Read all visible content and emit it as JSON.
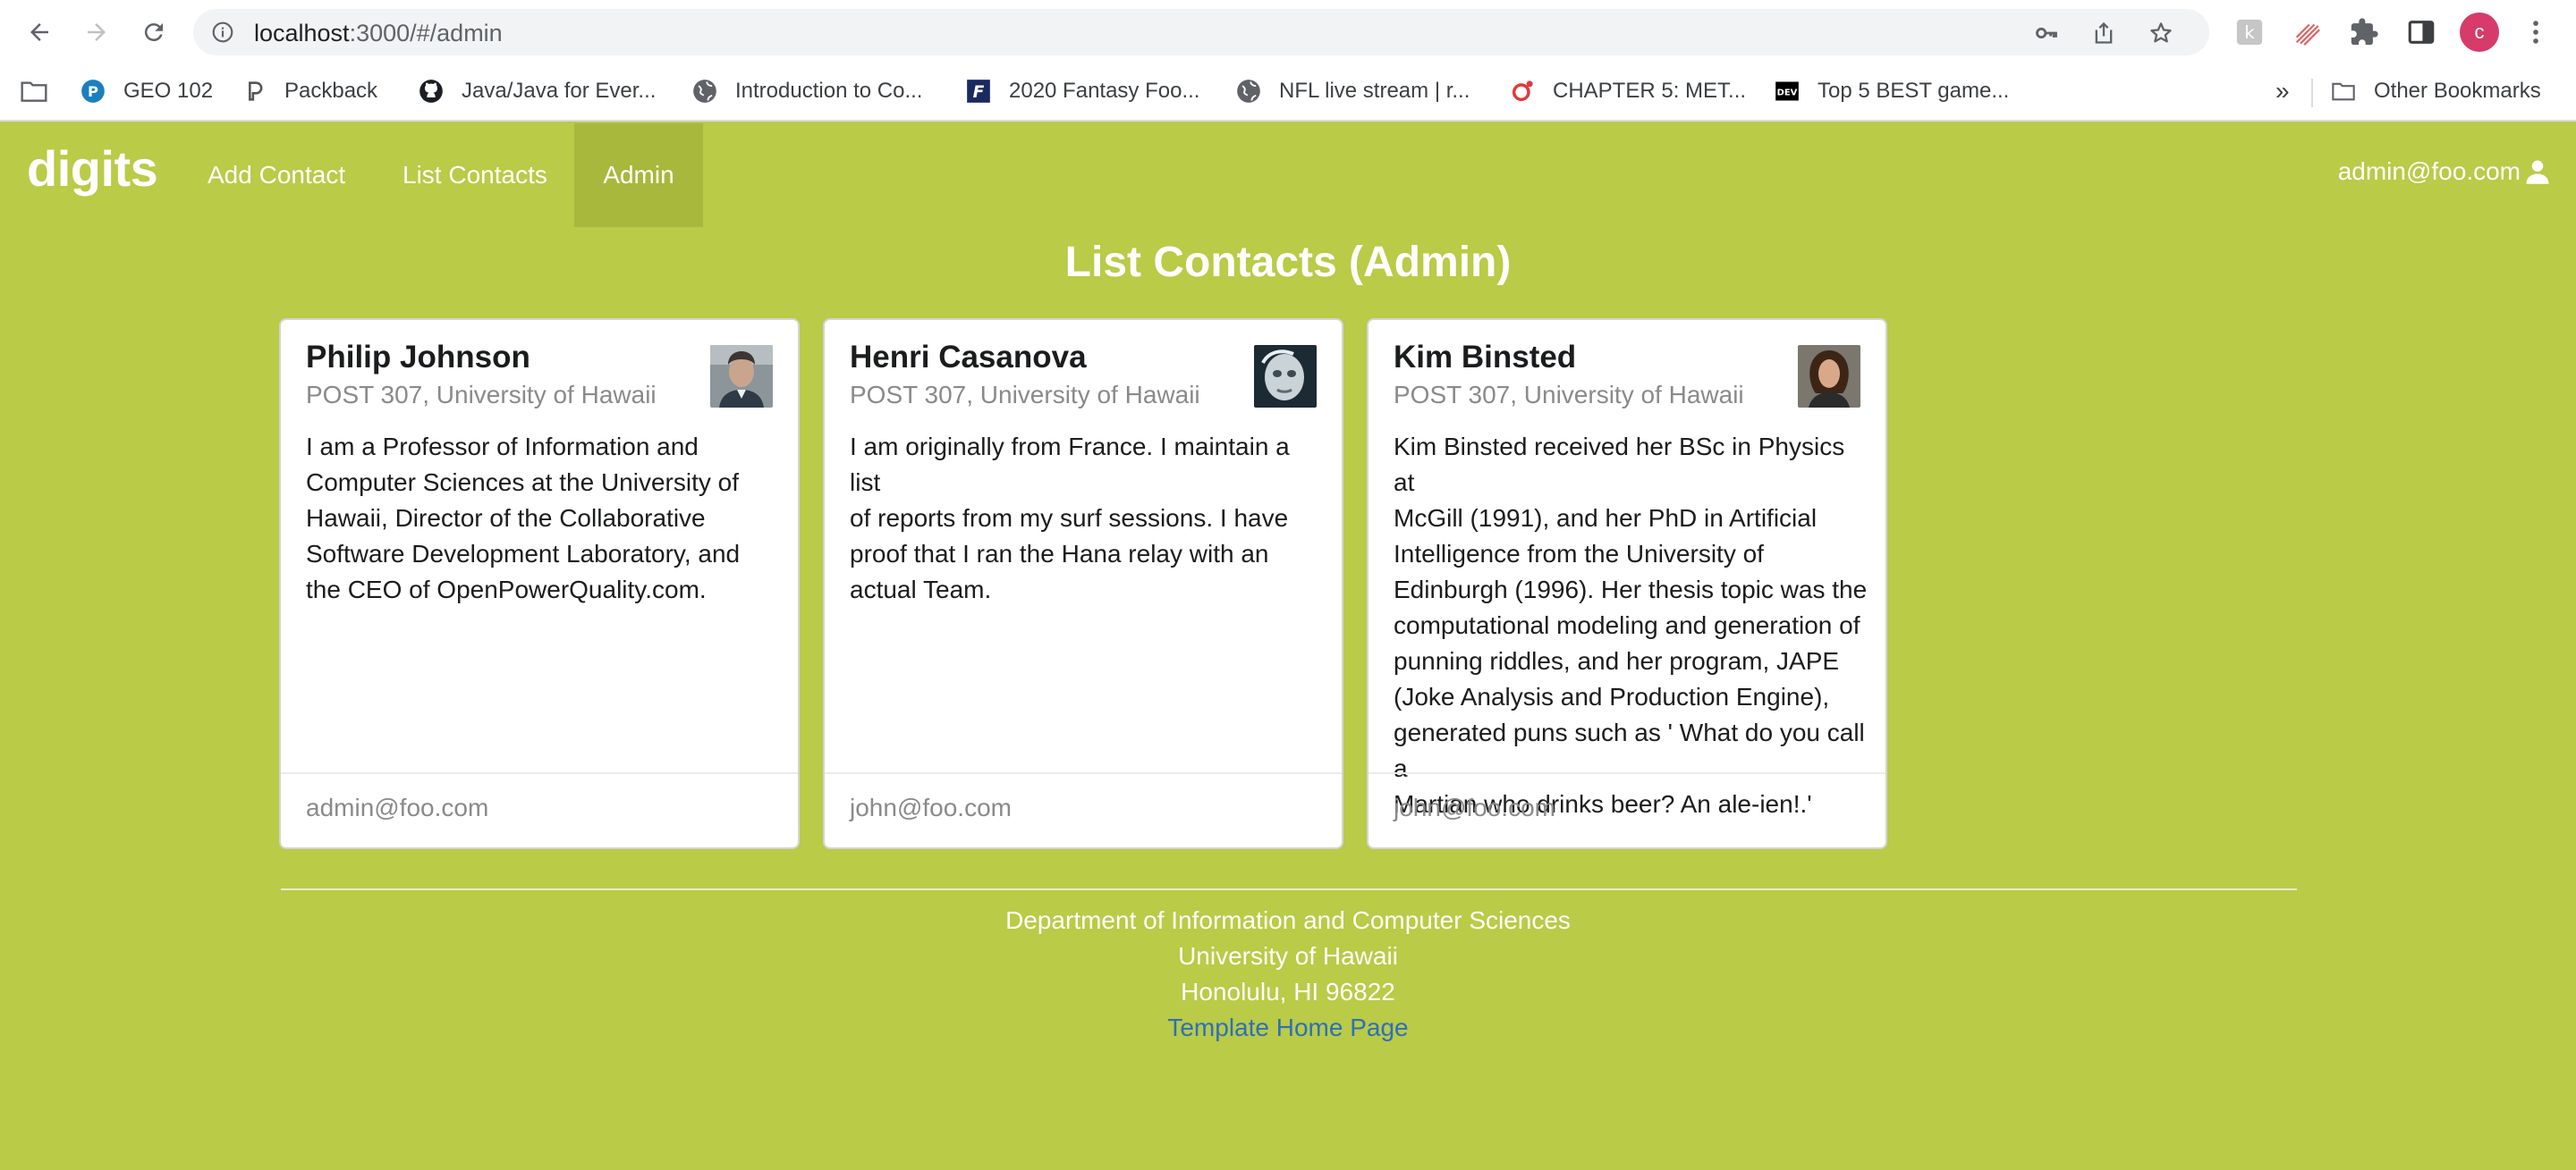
{
  "browser": {
    "url_host": "localhost",
    "url_path": ":3000/#/admin",
    "profile_initial": "c",
    "bookmarks": [
      {
        "label": "GEO 102",
        "icon": "pearson-icon"
      },
      {
        "label": "Packback",
        "icon": "packback-icon"
      },
      {
        "label": "Java/Java for Ever...",
        "icon": "github-icon"
      },
      {
        "label": "Introduction to Co...",
        "icon": "globe-icon"
      },
      {
        "label": "2020 Fantasy Foo...",
        "icon": "fantasy-icon"
      },
      {
        "label": "NFL live stream | r...",
        "icon": "globe-icon"
      },
      {
        "label": "CHAPTER 5: MET...",
        "icon": "target-icon"
      },
      {
        "label": "Top 5 BEST game...",
        "icon": "dev-icon"
      }
    ],
    "bookmarks_overflow": "»",
    "other_bookmarks": "Other Bookmarks",
    "dev_badge": "DEV",
    "pearson_badge": "P",
    "fantasy_badge": "F"
  },
  "nav": {
    "brand": "digits",
    "items": [
      {
        "label": "Add Contact"
      },
      {
        "label": "List Contacts"
      },
      {
        "label": "Admin"
      }
    ],
    "user": "admin@foo.com"
  },
  "main": {
    "title": "List Contacts (Admin)",
    "contacts": [
      {
        "name": "Philip Johnson",
        "address": "POST 307, University of Hawaii",
        "description_lines": [
          "I am a Professor of Information and",
          "Computer Sciences at the University of",
          "Hawaii, Director of the Collaborative",
          "Software Development Laboratory, and",
          "the CEO of OpenPowerQuality.com."
        ],
        "owner": "admin@foo.com"
      },
      {
        "name": "Henri Casanova",
        "address": "POST 307, University of Hawaii",
        "description_lines": [
          "I am originally from France. I maintain a list",
          "of reports from my surf sessions. I have",
          "proof that I ran the Hana relay with an",
          "actual Team."
        ],
        "owner": "john@foo.com"
      },
      {
        "name": "Kim Binsted",
        "address": "POST 307, University of Hawaii",
        "description_lines": [
          "Kim Binsted received her BSc in Physics at",
          "McGill (1991), and her PhD in Artificial",
          "Intelligence from the University of",
          "Edinburgh (1996). Her thesis topic was the",
          "computational modeling and generation of",
          "punning riddles, and her program, JAPE",
          "(Joke Analysis and Production Engine),",
          "generated puns such as ' What do you call a",
          "Martian who drinks beer? An ale-ien!.'"
        ],
        "owner": "john@foo.com"
      }
    ]
  },
  "footer": {
    "line1": "Department of Information and Computer Sciences",
    "line2": "University of Hawaii",
    "line3": "Honolulu, HI 96822",
    "link": "Template Home Page"
  },
  "colors": {
    "background": "#b9cb47",
    "active_nav": "#a8b83c",
    "link": "#2f6fb8"
  }
}
